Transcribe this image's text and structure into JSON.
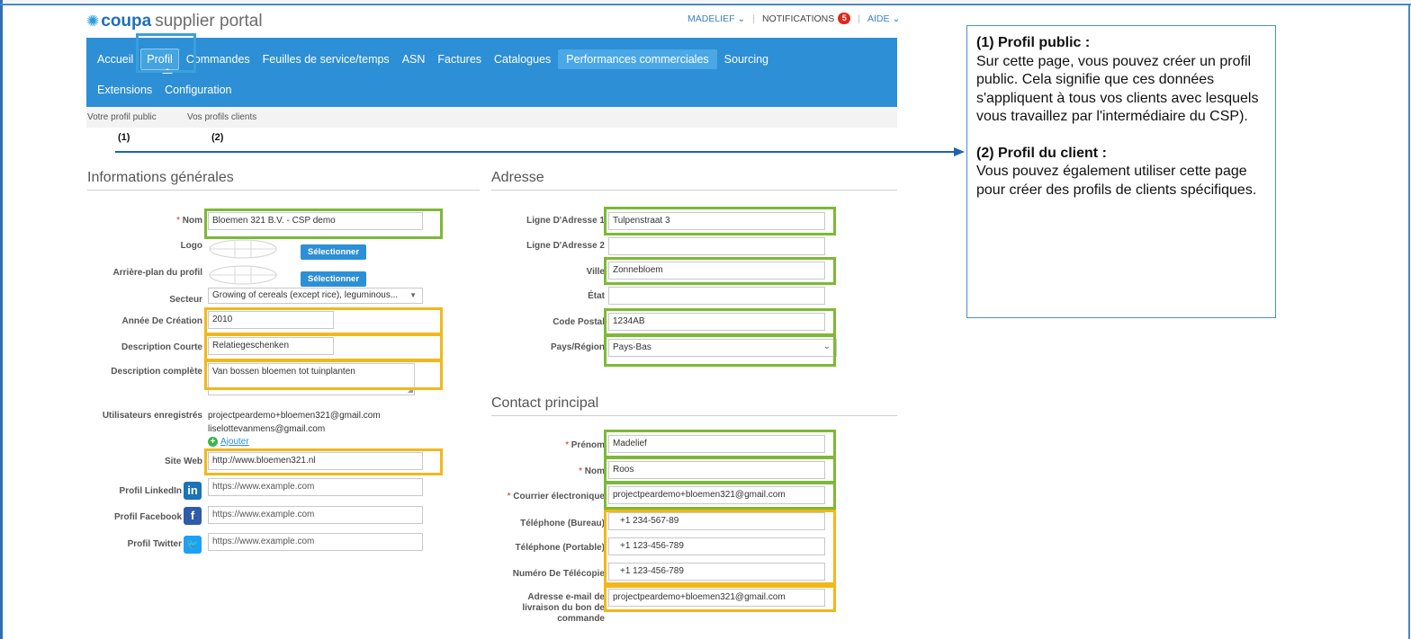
{
  "header": {
    "logo_brand": "coupa",
    "logo_rest": "supplier portal",
    "user_menu": "MADELIEF ⌄",
    "notifications_label": "NOTIFICATIONS",
    "notifications_count": "5",
    "help_menu": "AIDE ⌄"
  },
  "nav": {
    "row1": [
      "Accueil",
      "Profil",
      "Commandes",
      "Feuilles de service/temps",
      "ASN",
      "Factures",
      "Catalogues",
      "Performances commerciales",
      "Sourcing"
    ],
    "row2": [
      "Extensions",
      "Configuration"
    ],
    "active": "Profil"
  },
  "subnav": {
    "public_profile": "Votre profil public",
    "client_profiles": "Vos profils clients"
  },
  "annotations": {
    "label1": "(1)",
    "label2": "(2)"
  },
  "callout": {
    "title1": "(1) Profil public :",
    "body1": "Sur cette page, vous pouvez créer un profil public. Cela signifie que ces données s'appliquent à tous vos clients avec lesquels vous travaillez par l'intermédiaire du CSP).",
    "title2": "(2) Profil du client :",
    "body2": "Vous pouvez également utiliser cette page pour créer des profils de clients spécifiques."
  },
  "general": {
    "title": "Informations générales",
    "name_label": "Nom",
    "name_value": "Bloemen 321 B.V. - CSP demo",
    "logo_label": "Logo",
    "select_label": "Sélectionner",
    "background_label": "Arrière-plan du profil",
    "sector_label": "Secteur",
    "sector_value": "Growing of cereals (except rice), leguminous...",
    "year_label": "Année De Création",
    "year_value": "2010",
    "short_desc_label": "Description Courte",
    "short_desc_value": "Relatiegeschenken",
    "full_desc_label": "Description complète",
    "full_desc_value": "Van bossen bloemen tot tuinplanten",
    "users_label": "Utilisateurs enregistrés",
    "users": [
      "projectpeardemo+bloemen321@gmail.com",
      "liselottevanmens@gmail.com"
    ],
    "add_label": "Ajouter",
    "website_label": "Site Web",
    "website_value": "http://www.bloemen321.nl",
    "linkedin_label": "Profil LinkedIn",
    "linkedin_placeholder": "https://www.example.com",
    "facebook_label": "Profil Facebook",
    "facebook_placeholder": "https://www.example.com",
    "twitter_label": "Profil Twitter",
    "twitter_placeholder": "https://www.example.com"
  },
  "address": {
    "title": "Adresse",
    "line1_label": "Ligne D'Adresse 1",
    "line1_value": "Tulpenstraat 3",
    "line2_label": "Ligne D'Adresse 2",
    "line2_value": "",
    "city_label": "Ville",
    "city_value": "Zonnebloem",
    "state_label": "État",
    "state_value": "",
    "postal_label": "Code Postal",
    "postal_value": "1234AB",
    "country_label": "Pays/Région",
    "country_value": "Pays-Bas"
  },
  "contact": {
    "title": "Contact principal",
    "firstname_label": "Prénom",
    "firstname_value": "Madelief",
    "lastname_label": "Nom",
    "lastname_value": "Roos",
    "email_label": "Courrier électronique",
    "email_value": "projectpeardemo+bloemen321@gmail.com",
    "phone_office_label": "Téléphone (Bureau)",
    "phone_office_value": "+1 234-567-89",
    "phone_mobile_label": "Téléphone (Portable)",
    "phone_mobile_value": "+1 123-456-789",
    "fax_label": "Numéro De Télécopie",
    "fax_value": "+1 123-456-789",
    "po_email_label_1": "Adresse e-mail de",
    "po_email_label_2": "livraison du bon de",
    "po_email_label_3": "commande",
    "po_email_value": "projectpeardemo+bloemen321@gmail.com"
  },
  "colors": {
    "nav_blue": "#2d8fd5",
    "highlight_green": "#7cb935",
    "highlight_yellow": "#f2b71a",
    "highlight_blue": "#3aa0dc",
    "arrow_blue": "#1f63ad"
  }
}
